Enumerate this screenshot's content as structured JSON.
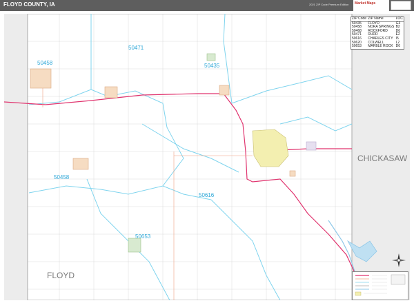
{
  "header": {
    "title": "FLOYD COUNTY, IA",
    "edition": "2021 ZIP Code Premium Edition",
    "brand": "Market Maps"
  },
  "labels": {
    "zip_50471": "50471",
    "zip_50458_north": "50458",
    "zip_50435": "50435",
    "zip_50458_west": "50458",
    "zip_50616": "50616",
    "zip_50653": "50653",
    "county_chickasaw": "CHICKASAW",
    "county_floyd": "FLOYD"
  },
  "legend": {
    "headers": [
      "ZIP Code",
      "ZIP Name",
      "LOC"
    ],
    "rows": [
      [
        "50435",
        "FLOYD",
        "G3"
      ],
      [
        "50458",
        "NORA SPRINGS",
        "B2"
      ],
      [
        "50468",
        "ROCKFORD",
        "D6"
      ],
      [
        "50471",
        "RUDD",
        "E2"
      ],
      [
        "50616",
        "CHARLES CITY",
        "I5"
      ],
      [
        "50620",
        "COLWELL",
        "L2"
      ],
      [
        "50653",
        "MARBLE ROCK",
        "D6"
      ]
    ]
  },
  "colors": {
    "zip_label": "#2fa8d8",
    "zip_boundary": "#7fd4ee",
    "highway": "#e0336e",
    "county_line": "#b0b0b0",
    "water": "#8fc8e8",
    "city_fill": "#f3efb0",
    "titlebar": "#5e5e5e"
  }
}
